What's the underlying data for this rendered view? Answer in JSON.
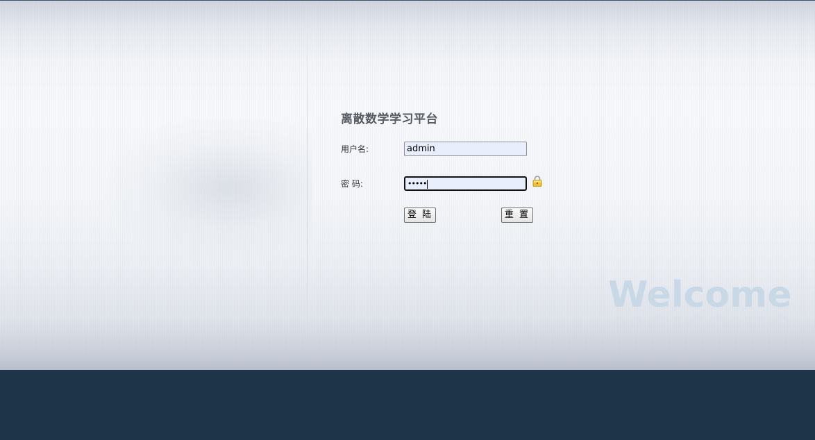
{
  "login": {
    "title": "离散数学学习平台",
    "username_label": "用户名:",
    "username_value": "admin",
    "password_label": "密 码:",
    "password_masked": "•••••",
    "login_button": "登 陆",
    "reset_button": "重 置"
  },
  "decor": {
    "welcome_text": "Welcome",
    "lock_icon": "lock-icon"
  },
  "colors": {
    "footer": "#1e3449",
    "title": "#555a62",
    "welcome": "#c9d8e6",
    "input_bg": "#e8eefb"
  }
}
